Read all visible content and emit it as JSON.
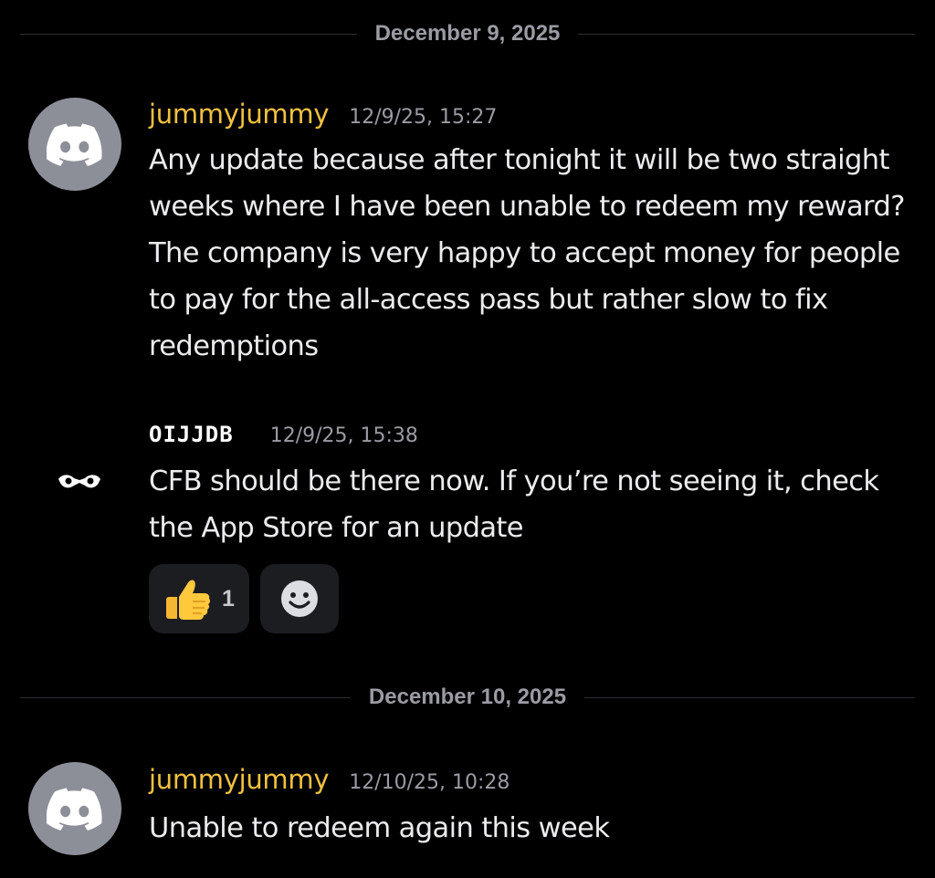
{
  "dividers": [
    {
      "label": "December 9, 2025"
    },
    {
      "label": "December 10, 2025"
    }
  ],
  "messages": [
    {
      "author": "jummyjummy",
      "timestamp": "12/9/25, 15:27",
      "text": "Any update because after tonight it will be two straight weeks where I have been unable to redeem my reward? The company is very happy to accept money for people to pay for the all-access pass but rather slow to fix redemptions",
      "avatar_icon": "discord-logo-icon"
    },
    {
      "author": "OIJJDB",
      "timestamp": "12/9/25, 15:38",
      "text": "CFB should be there now. If you’re not seeing it, check the App Store for an update",
      "avatar_icon": "masked-badge-icon",
      "reactions": [
        {
          "emoji": "thumbs-up-icon",
          "count": "1"
        },
        {
          "emoji": "add-reaction-smiley-icon"
        }
      ]
    },
    {
      "author": "jummyjummy",
      "timestamp": "12/10/25, 10:28",
      "text": "Unable to redeem again this week",
      "avatar_icon": "discord-logo-icon"
    }
  ],
  "colors": {
    "background": "#000000",
    "username": "#f0c040",
    "timestamp": "#9a9ba3",
    "message_text": "#ececef",
    "avatar_bg": "#8d8f98",
    "reaction_bg": "#1c1d21"
  }
}
